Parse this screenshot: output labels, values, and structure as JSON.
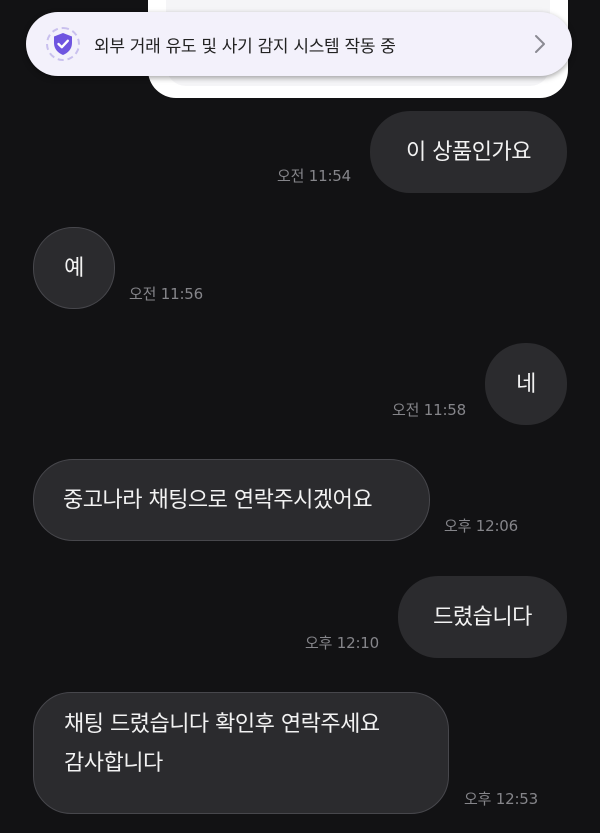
{
  "banner": {
    "text": "외부 거래 유도 및 사기 감지 시스템 작동 중",
    "icon": "shield-check-icon",
    "chevron": "chevron-right-icon",
    "accent_color": "#6f55e0"
  },
  "messages": [
    {
      "direction": "outgoing",
      "text": "이 상품인가요",
      "time": "오전 11:54"
    },
    {
      "direction": "incoming",
      "text": "예",
      "time": "오전 11:56"
    },
    {
      "direction": "outgoing",
      "text": "네",
      "time": "오전 11:58"
    },
    {
      "direction": "incoming",
      "text": "중고나라 채팅으로 연락주시겠어요",
      "time": "오후 12:06"
    },
    {
      "direction": "outgoing",
      "text": "드렸습니다",
      "time": "오후 12:10"
    },
    {
      "direction": "incoming",
      "lines": [
        "채팅 드렸습니다 확인후 연락주세요",
        "감사합니다"
      ],
      "time": "오후 12:53"
    }
  ],
  "colors": {
    "background": "#121214",
    "bubble": "#2b2b2e",
    "bubble_border": "#47474c",
    "text": "#f2f2f2",
    "time": "#85858a",
    "banner_bg": "#f3f1fb"
  }
}
